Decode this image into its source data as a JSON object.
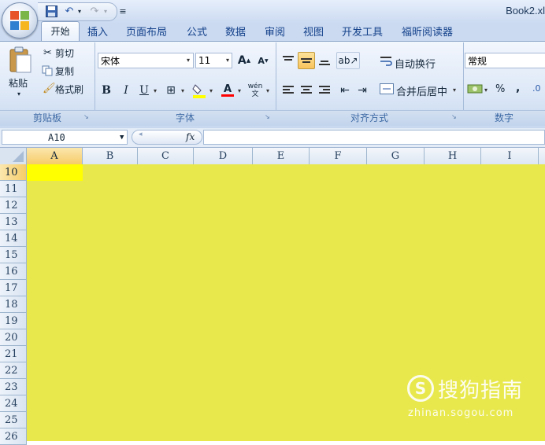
{
  "window": {
    "title": "Book2.xl"
  },
  "colors": {
    "fill": "#e8e84d",
    "active_cell": "#ffff00"
  },
  "quick_access": {
    "icons": [
      "save-icon",
      "undo-icon",
      "redo-icon",
      "customize-icon"
    ]
  },
  "tabs": [
    {
      "label": "开始",
      "active": true
    },
    {
      "label": "插入"
    },
    {
      "label": "页面布局"
    },
    {
      "label": "公式"
    },
    {
      "label": "数据"
    },
    {
      "label": "审阅"
    },
    {
      "label": "视图"
    },
    {
      "label": "开发工具"
    },
    {
      "label": "福昕阅读器"
    }
  ],
  "clipboard": {
    "paste": "粘贴",
    "cut": "剪切",
    "copy": "复制",
    "format_painter": "格式刷",
    "group": "剪贴板"
  },
  "font": {
    "name": "宋体",
    "size": "11",
    "group": "字体",
    "bold": "B",
    "italic": "I",
    "underline": "U",
    "grow": "A",
    "shrink": "A",
    "color_letter": "A",
    "phonetic": "wén"
  },
  "alignment": {
    "wrap": "自动换行",
    "merge": "合并后居中",
    "group": "对齐方式"
  },
  "number": {
    "format": "常规",
    "percent": "%",
    "comma": ",",
    "group": "数字"
  },
  "formula_bar": {
    "name_box": "A10",
    "fx": "fx",
    "content": ""
  },
  "columns": [
    "A",
    "B",
    "C",
    "D",
    "E",
    "F",
    "G",
    "H",
    "I"
  ],
  "rows": [
    "10",
    "11",
    "12",
    "13",
    "14",
    "15",
    "16",
    "17",
    "18",
    "19",
    "20",
    "21",
    "22",
    "23",
    "24",
    "25",
    "26"
  ],
  "watermark": {
    "text": "搜狗指南",
    "url": "zhinan.sogou.com"
  }
}
